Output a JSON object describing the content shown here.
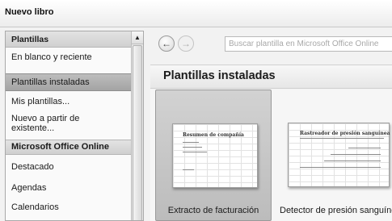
{
  "window": {
    "title": "Nuevo libro"
  },
  "sidebar": {
    "header": "Plantillas",
    "items": [
      {
        "label": "En blanco y reciente",
        "selected": false,
        "section": false
      },
      {
        "label": "Plantillas instaladas",
        "selected": true,
        "section": false
      },
      {
        "label": "Mis plantillas...",
        "selected": false,
        "section": false
      },
      {
        "label": "Nuevo a partir de existente...",
        "selected": false,
        "section": false
      },
      {
        "label": "Microsoft Office Online",
        "selected": false,
        "section": true
      },
      {
        "label": "Destacado",
        "selected": false,
        "section": false
      },
      {
        "label": "Agendas",
        "selected": false,
        "section": false
      },
      {
        "label": "Calendarios",
        "selected": false,
        "section": false
      }
    ],
    "scroll_up_glyph": "▲"
  },
  "toolbar": {
    "back_glyph": "←",
    "forward_glyph": "→",
    "search_placeholder": "Buscar plantilla en Microsoft Office Online"
  },
  "main": {
    "title": "Plantillas instaladas",
    "templates": [
      {
        "label": "Extracto de facturación",
        "selected": true,
        "preview_heading": "Resumen de compañía"
      },
      {
        "label": "Detector de presión sanguínea",
        "selected": false,
        "preview_heading": "Rastreador de presión sanguínea"
      }
    ]
  }
}
